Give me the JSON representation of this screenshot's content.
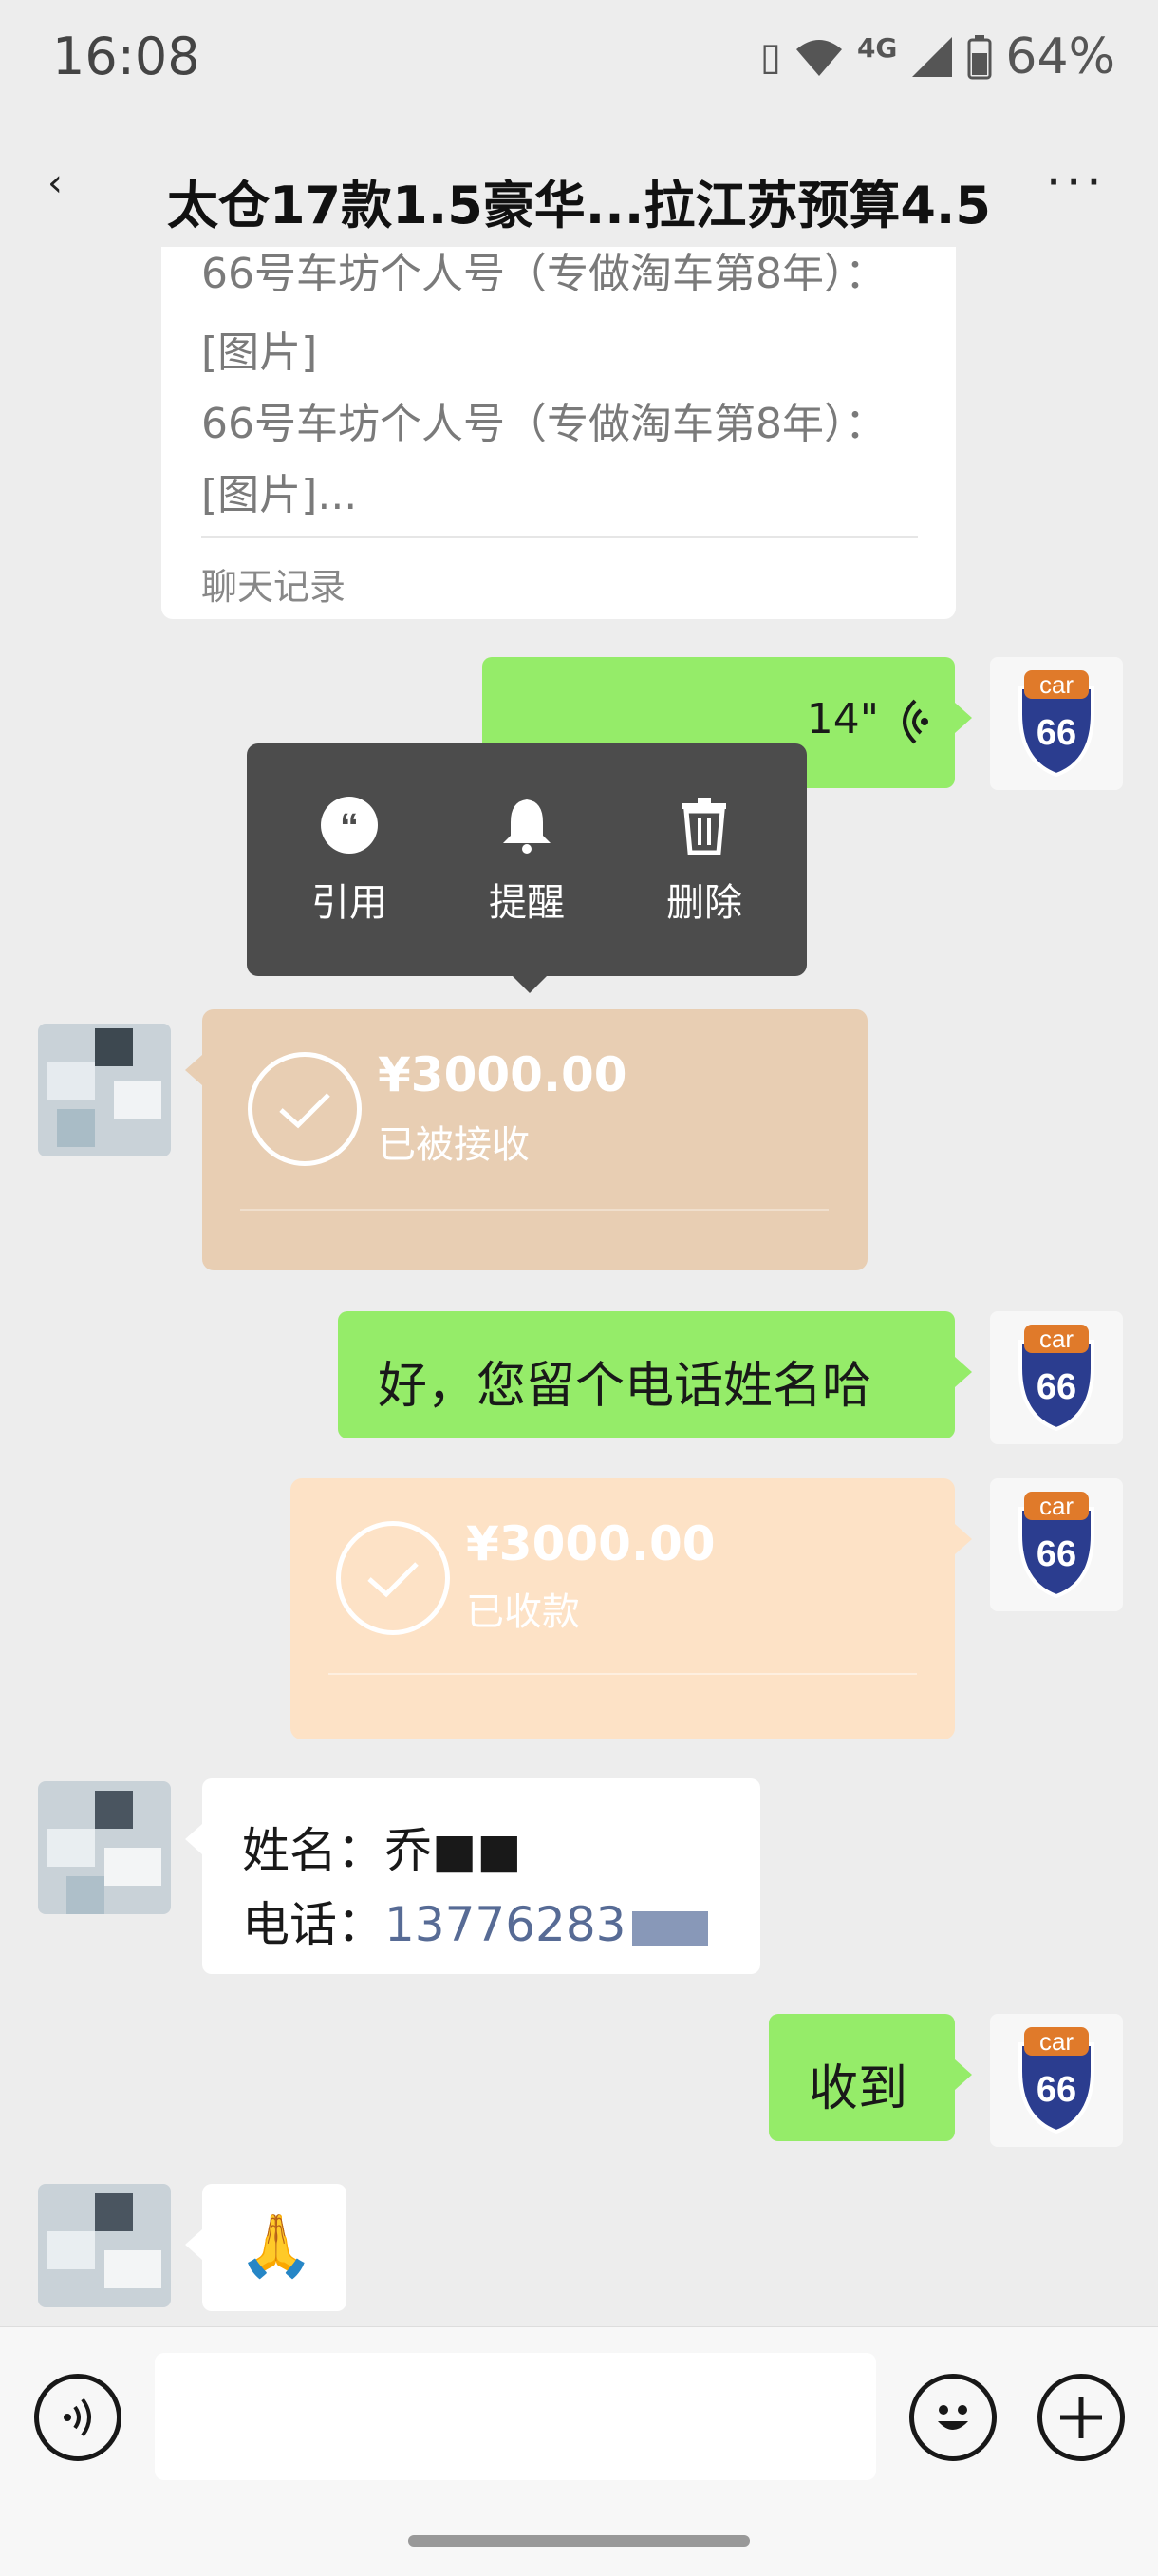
{
  "status_bar": {
    "time": "16:08",
    "network": "4G",
    "battery": "64%"
  },
  "nav": {
    "back": "‹",
    "title": "太仓17款1.5豪华...拉江苏预算4.5",
    "more": "···"
  },
  "record_card": {
    "line1": "66号车坊个人号（专做淘车第8年）：",
    "line2": "[图片]",
    "line3": "66号车坊个人号（专做淘车第8年）：",
    "line4": "[图片]...",
    "footer": "聊天记录"
  },
  "voice_message": {
    "duration": "14\""
  },
  "context_menu": {
    "quote": "引用",
    "remind": "提醒",
    "delete": "删除"
  },
  "transfer_received_incoming": {
    "amount": "¥3000.00",
    "status": "已被接收"
  },
  "msg_phone_request": "好，您留个电话姓名哈",
  "transfer_received_outgoing": {
    "amount": "¥3000.00",
    "status": "已收款"
  },
  "contact_message": {
    "name_label": "姓名：",
    "name_value": "乔■■",
    "phone_label": "电话：",
    "phone_value": "13776283"
  },
  "msg_received": "收到",
  "emoji_message": "🙏",
  "avatar_brand": {
    "top": "car",
    "number": "66"
  },
  "colors": {
    "green_bubble": "#95ec69",
    "transfer_dim": "#e8ceb3",
    "transfer_light": "#fde2c6",
    "link_blue": "#576b95"
  }
}
